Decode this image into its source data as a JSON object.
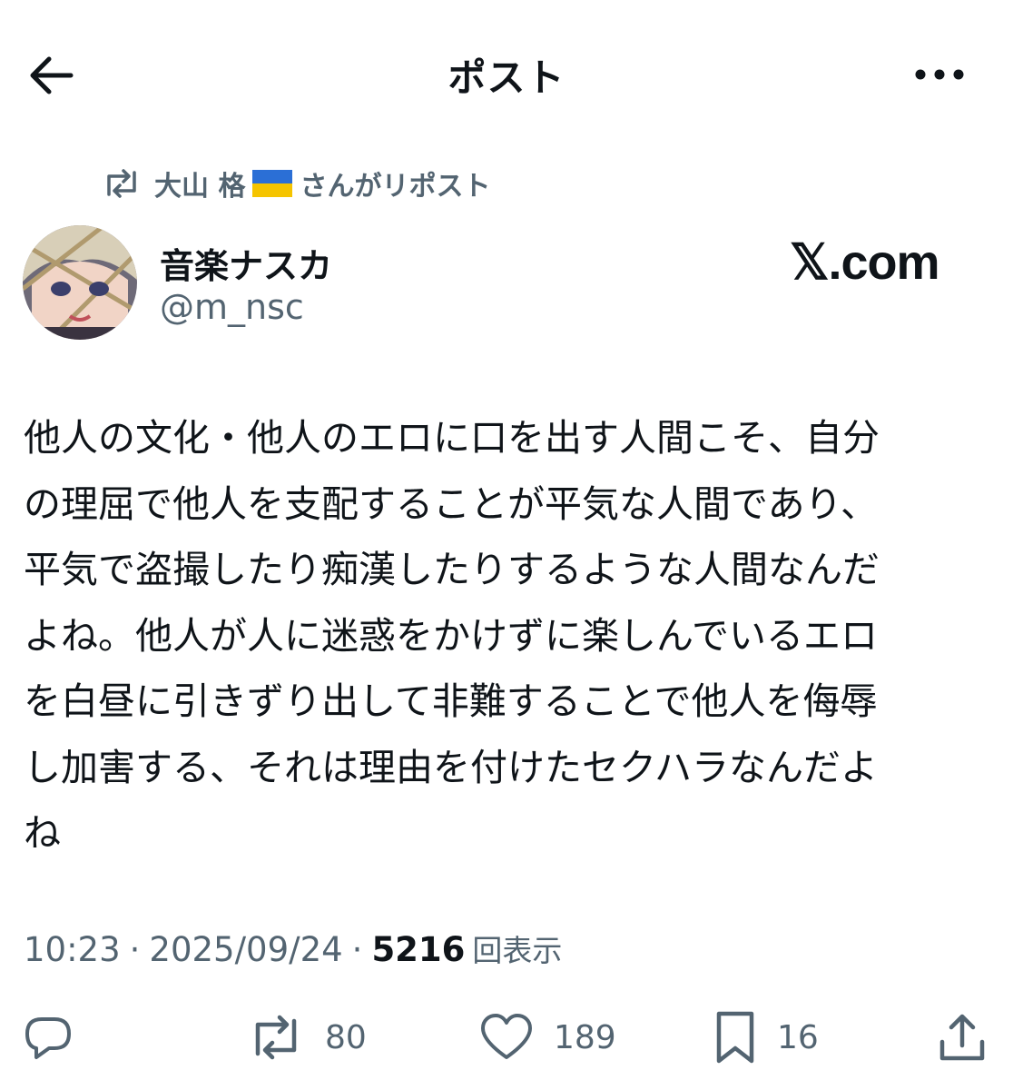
{
  "header": {
    "title": "ポスト"
  },
  "repost": {
    "user": "大山 格",
    "suffix": "さんがリポスト"
  },
  "author": {
    "display_name": "音楽ナスカ",
    "handle": "@m_nsc"
  },
  "watermark": "𝕏.com",
  "post": {
    "text": "他人の文化・他人のエロに口を出す人間こそ、自分\nの理屈で他人を支配することが平気な人間であり、\n平気で盗撮したり痴漢したりするような人間なんだ\nよね。他人が人に迷惑をかけずに楽しんでいるエロ\nを白昼に引きずり出して非難することで他人を侮辱\nし加害する、それは理由を付けたセクハラなんだよ\nね"
  },
  "meta": {
    "time": "10:23",
    "separator": "·",
    "date": "2025/09/24",
    "views": "5216",
    "views_label": "回表示"
  },
  "actions": {
    "reply_icon": "reply-icon",
    "repost_count": "80",
    "like_count": "189",
    "bookmark_count": "16",
    "share_icon": "share-icon"
  },
  "colors": {
    "text": "#0f1419",
    "secondary": "#536471",
    "flag_blue": "#2b6fd6",
    "flag_yellow": "#f5c400"
  }
}
